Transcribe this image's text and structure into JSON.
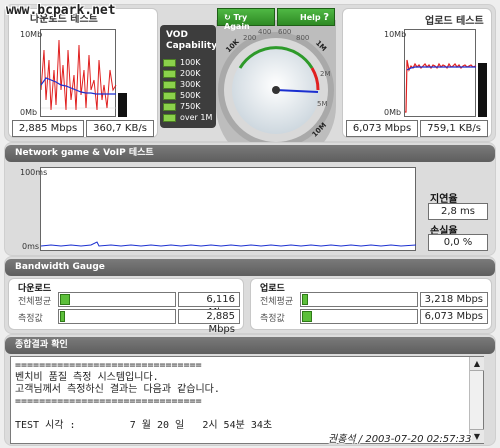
{
  "watermark": "www.bcpark.net",
  "download": {
    "title": "다운로드 테스트",
    "graph_top_label": "10Mb",
    "graph_bottom_label": "0Mb",
    "mbps": "2,885 Mbps",
    "kbs": "360,7 KB/s"
  },
  "upload": {
    "title": "업로드 테스트",
    "graph_top_label": "10Mb",
    "graph_bottom_label": "0Mb",
    "mbps": "6,073 Mbps",
    "kbs": "759,1 KB/s"
  },
  "vod": {
    "title_line1": "VOD",
    "title_line2": "Capability",
    "items": [
      "100K",
      "200K",
      "300K",
      "500K",
      "750K",
      "over 1M"
    ]
  },
  "meter": {
    "try_again": "Try Again",
    "help": "Help",
    "help_icon": "?",
    "labels": [
      "10K",
      "200",
      "400",
      "600",
      "800",
      "1M",
      "2M",
      "5M",
      "10M"
    ]
  },
  "network": {
    "section_title": "Network game & VoIP 테스트",
    "top_label": "100ms",
    "bottom_label": "0ms",
    "latency_label": "지연율",
    "latency_value": "2,8 ms",
    "loss_label": "손실율",
    "loss_value": "0,0 %"
  },
  "bandwidth": {
    "section_title": "Bandwidth Gauge",
    "download_title": "다운로드",
    "upload_title": "업로드",
    "avg_label": "전체평균",
    "measured_label": "측정값",
    "download_avg": "6,116 Mbps",
    "download_measured": "2,885 Mbps",
    "upload_avg": "3,218 Mbps",
    "upload_measured": "6,073 Mbps"
  },
  "result": {
    "section_title": "종합결과 확인",
    "lines": [
      "===============================",
      "벤치비 품질 측정 시스템입니다.",
      "고객님께서 측정하신 결과는 다음과 같습니다.",
      "===============================",
      "",
      "TEST 시각 :         7 월 20 일   2시 54분 34초"
    ]
  },
  "signature": "권홍석 / 2003-07-20 02:57:33",
  "colors": {
    "section_bar": "#6a6a6a",
    "graph_red": "#e02020",
    "graph_blue": "#1a2fd0",
    "gauge_green": "#5cbf3a",
    "button_green": "#2e8a24"
  }
}
